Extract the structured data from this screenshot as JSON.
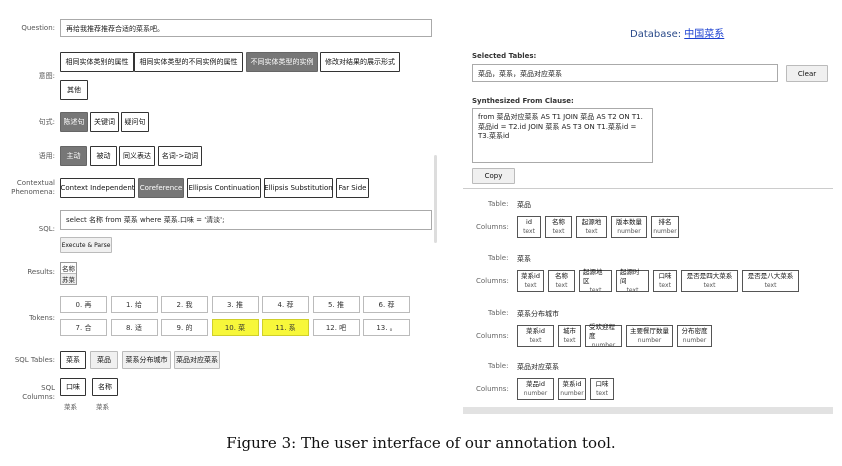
{
  "left": {
    "question_label": "Question:",
    "question_value": "再给我推荐推荐合适的菜系吧。",
    "intent_label": "意图:",
    "intent_options": [
      "相同实体类别的属性",
      "相同实体类型的不同实例的属性",
      "不同实体类型的实例",
      "修改对结果的展示形式",
      "其他"
    ],
    "intent_selected": 2,
    "sentence_label": "句式:",
    "sentence_options": [
      "陈述句",
      "关键词",
      "疑问句"
    ],
    "sentence_selected": 0,
    "voice_label": "语用:",
    "voice_options": [
      "主动",
      "被动",
      "同义表达",
      "名词->动词"
    ],
    "voice_selected": 0,
    "phen_label_1": "Contextual",
    "phen_label_2": "Phenomena:",
    "phen_options": [
      "Context Independent",
      "Coreference",
      "Ellipsis Continuation",
      "Ellipsis Substitution",
      "Far Side"
    ],
    "phen_selected": 1,
    "sql_label": "SQL:",
    "sql_value": "select 名称 from 菜系 where 菜系.口味 = '清淡';",
    "execute_label": "Execute & Parse",
    "results_label": "Results:",
    "results_header": "名称",
    "results_value": "苏菜",
    "tokens_label": "Tokens:",
    "tokens": [
      "0. 再",
      "1. 给",
      "2. 我",
      "3. 推",
      "4. 荐",
      "5. 推",
      "6. 荐",
      "7. 合",
      "8. 适",
      "9. 的",
      "10. 菜",
      "11. 系",
      "12. 吧",
      "13. 。"
    ],
    "tokens_highlighted": [
      10,
      11
    ],
    "sql_tables_label": "SQL Tables:",
    "sql_tables": [
      "菜系",
      "菜品",
      "菜系分布城市",
      "菜品对应菜系"
    ],
    "sql_columns_label_1": "SQL",
    "sql_columns_label_2": "Columns:",
    "sql_columns": [
      {
        "name": "口味",
        "table": "菜系"
      },
      {
        "name": "名称",
        "table": "菜系"
      }
    ]
  },
  "right": {
    "db_label": "Database:",
    "db_name": "中国菜系",
    "selected_tables_label": "Selected Tables:",
    "selected_tables_value": "菜品，菜系，菜品对应菜系",
    "clear_label": "Clear",
    "from_label": "Synthesized From Clause:",
    "from_value": "from 菜品对应菜系 AS T1 JOIN 菜品 AS T2 ON T1.菜品id = T2.id JOIN 菜系 AS T3 ON T1.菜系id = T3.菜系id",
    "copy_label": "Copy",
    "table_label": "Table:",
    "columns_label": "Columns:",
    "tables": [
      {
        "name": "菜品",
        "columns": [
          {
            "n": "id",
            "t": "text"
          },
          {
            "n": "名称",
            "t": "text"
          },
          {
            "n": "起源地",
            "t": "text"
          },
          {
            "n": "版本数量",
            "t": "number"
          },
          {
            "n": "排名",
            "t": "number"
          }
        ]
      },
      {
        "name": "菜系",
        "columns": [
          {
            "n": "菜系id",
            "t": "text"
          },
          {
            "n": "名称",
            "t": "text"
          },
          {
            "n": "起源地区",
            "t": "text"
          },
          {
            "n": "起源时间",
            "t": "text"
          },
          {
            "n": "口味",
            "t": "text"
          },
          {
            "n": "是否是四大菜系",
            "t": "text"
          },
          {
            "n": "是否是八大菜系",
            "t": "text"
          }
        ]
      },
      {
        "name": "菜系分布城市",
        "columns": [
          {
            "n": "菜系id",
            "t": "text"
          },
          {
            "n": "城市",
            "t": "text"
          },
          {
            "n": "受欢迎程度",
            "t": "number"
          },
          {
            "n": "主要餐厅数量",
            "t": "number"
          },
          {
            "n": "分布密度",
            "t": "number"
          }
        ]
      },
      {
        "name": "菜品对应菜系",
        "columns": [
          {
            "n": "菜品id",
            "t": "number"
          },
          {
            "n": "菜系id",
            "t": "number"
          },
          {
            "n": "口味",
            "t": "text"
          }
        ]
      }
    ]
  },
  "caption": "Figure 3: The user interface of our annotation tool."
}
